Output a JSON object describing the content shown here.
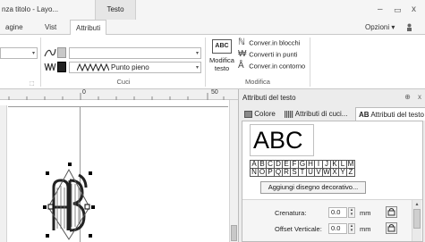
{
  "window": {
    "title": "nza titolo - Layo...",
    "context_tab": "Testo",
    "controls": {
      "minimize": "–",
      "maximize": "▭",
      "close": "x"
    }
  },
  "ribbon_tabs": [
    {
      "label": "agine"
    },
    {
      "label": "Vist"
    },
    {
      "label": "Attributi"
    }
  ],
  "ribbon_right": {
    "options_label": "Opzioni",
    "options_arrow": "▾",
    "account_icon": "person-icon"
  },
  "ribbon": {
    "cuci_group": {
      "label": "Cuci",
      "stitch_label": "Punto pieno"
    },
    "modifica_group": {
      "label": "Modifica",
      "big_button_icon_text": "ABC",
      "big_button_label_line1": "Modifica",
      "big_button_label_line2": "testo",
      "commands": [
        {
          "label": "Conver.in blocchi"
        },
        {
          "label": "Converti in punti"
        },
        {
          "label": "Conver.in contorno"
        }
      ]
    }
  },
  "ruler": {
    "marks": [
      "0",
      "50"
    ]
  },
  "panel": {
    "title": "Attributi del testo",
    "tabs": [
      {
        "label": "Colore"
      },
      {
        "label": "Attributi di cuci..."
      },
      {
        "label": "Attributi del testo"
      }
    ],
    "preview_text": "ABC",
    "char_rows": [
      [
        "A",
        "B",
        "C",
        "D",
        "E",
        "F",
        "G",
        "H",
        "I",
        "J",
        "K",
        "L",
        "M"
      ],
      [
        "N",
        "O",
        "P",
        "Q",
        "R",
        "S",
        "T",
        "U",
        "V",
        "W",
        "X",
        "Y",
        "Z"
      ]
    ],
    "decorative_button": "Aggiungi disegno decorativo...",
    "properties": [
      {
        "label": "Crenatura:",
        "value": "0.0",
        "unit": "mm"
      },
      {
        "label": "Offset Verticale:",
        "value": "0.0",
        "unit": "mm"
      }
    ]
  },
  "canvas": {
    "monogram_text": "ABC"
  }
}
